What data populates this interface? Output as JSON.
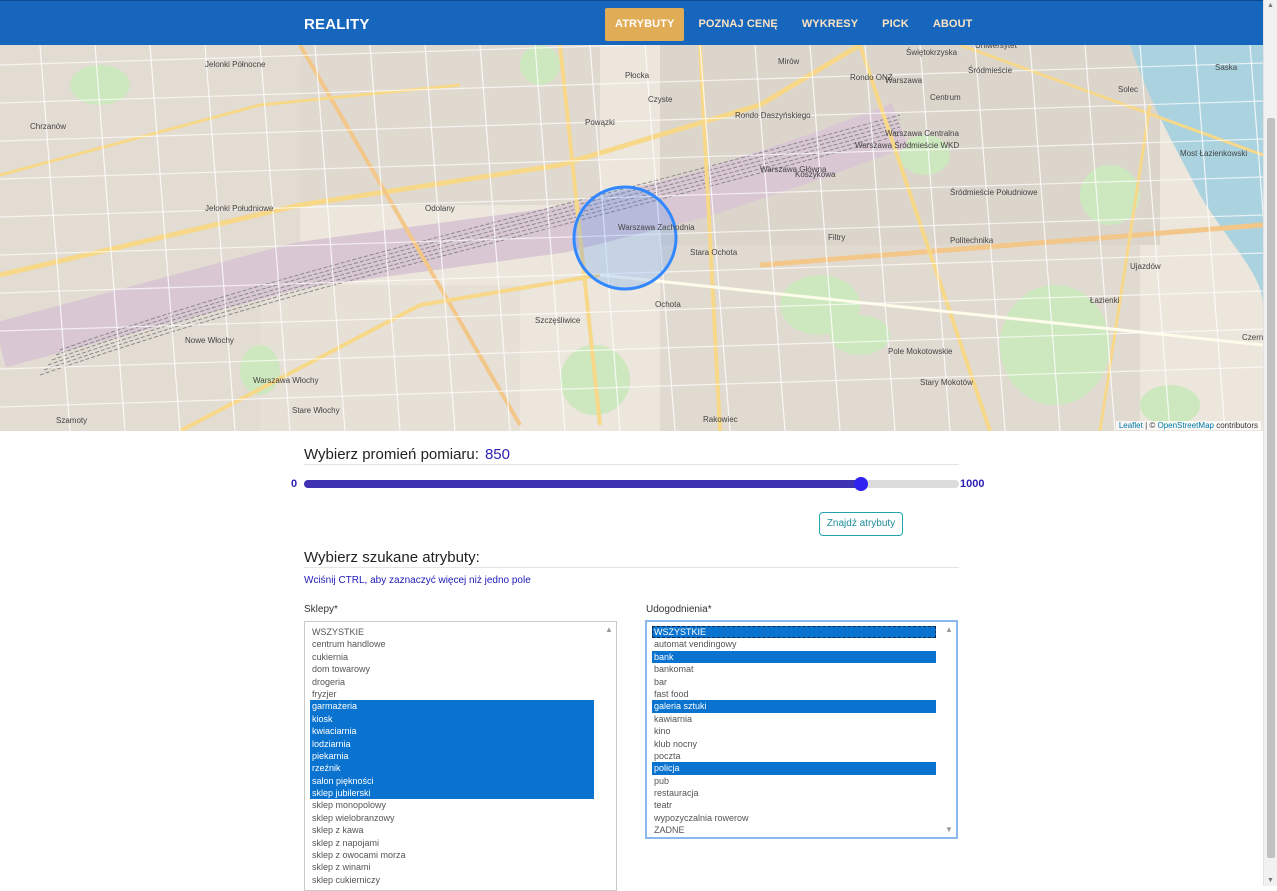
{
  "navbar": {
    "brand": "REALITY",
    "items": [
      {
        "label": "ATRYBUTY",
        "active": true
      },
      {
        "label": "POZNAJ CENĘ",
        "active": false
      },
      {
        "label": "WYKRESY",
        "active": false
      },
      {
        "label": "PICK",
        "active": false
      },
      {
        "label": "ABOUT",
        "active": false
      }
    ]
  },
  "map": {
    "labels": [
      "Jelonki Północne",
      "Chrzanów",
      "Jelonki Południowe",
      "Odolany",
      "Warszawa Zachodnia",
      "Szczęśliwice",
      "Stara Ochota",
      "Ochota",
      "Nowe Włochy",
      "Warszawa Włochy",
      "Stare Włochy",
      "Szamoty",
      "Filtry",
      "Śródmieście Południowe",
      "Warszawa",
      "Śródmieście",
      "Mirów",
      "Koszykowa",
      "Pole Mokotowskie",
      "Stary Mokotów",
      "Rakowiec",
      "Ujazdów",
      "Łazienki",
      "Most Łazienkowski",
      "Czyste",
      "Powązki",
      "Płocka",
      "Rondo Daszyńskiego",
      "Rondo ONZ",
      "Centrum",
      "Warszawa Główna",
      "Warszawa Centralna",
      "Warszawa Śródmieście WKD",
      "Politechnika",
      "Uniwersytet",
      "Świętokrzyska",
      "Solec",
      "Saska",
      "Czerni"
    ],
    "attribution": {
      "leaflet": "Leaflet",
      "sep": " | © ",
      "osm": "OpenStreetMap",
      "suffix": " contributors"
    }
  },
  "radius": {
    "title": "Wybierz promień pomiaru:",
    "value": "850",
    "min": "0",
    "max": "1000",
    "fraction": 0.85
  },
  "find_button": "Znajdź atrybuty",
  "attributes": {
    "title": "Wybierz szukane atrybuty:",
    "hint": "Wciśnij CTRL, aby zaznaczyć więcej niż jedno pole"
  },
  "shops": {
    "label": "Sklepy*",
    "options": [
      {
        "text": "WSZYSTKIE",
        "selected": false
      },
      {
        "text": "centrum handlowe",
        "selected": false
      },
      {
        "text": "cukiernia",
        "selected": false
      },
      {
        "text": "dom towarowy",
        "selected": false
      },
      {
        "text": "drogeria",
        "selected": false
      },
      {
        "text": "fryzjer",
        "selected": false
      },
      {
        "text": "garmażeria",
        "selected": true
      },
      {
        "text": "kiosk",
        "selected": true
      },
      {
        "text": "kwiaciarnia",
        "selected": true
      },
      {
        "text": "lodziarnia",
        "selected": true
      },
      {
        "text": "piekarnia",
        "selected": true
      },
      {
        "text": "rzeźnik",
        "selected": true
      },
      {
        "text": "salon piękności",
        "selected": true
      },
      {
        "text": "sklep jubilerski",
        "selected": true
      },
      {
        "text": "sklep monopolowy",
        "selected": false
      },
      {
        "text": "sklep wielobranzowy",
        "selected": false
      },
      {
        "text": "sklep z kawa",
        "selected": false
      },
      {
        "text": "sklep z napojami",
        "selected": false
      },
      {
        "text": "sklep z owocami morza",
        "selected": false
      },
      {
        "text": "sklep z winami",
        "selected": false
      },
      {
        "text": "sklep cukierniczy",
        "selected": false
      }
    ]
  },
  "amenities": {
    "label": "Udogodnienia*",
    "options": [
      {
        "text": "WSZYSTKIE",
        "selected": true,
        "focus": true
      },
      {
        "text": "automat vendingowy",
        "selected": false
      },
      {
        "text": "bank",
        "selected": true
      },
      {
        "text": "bankomat",
        "selected": false
      },
      {
        "text": "bar",
        "selected": false
      },
      {
        "text": "fast food",
        "selected": false
      },
      {
        "text": "galeria sztuki",
        "selected": true
      },
      {
        "text": "kawiarnia",
        "selected": false
      },
      {
        "text": "kino",
        "selected": false
      },
      {
        "text": "klub nocny",
        "selected": false
      },
      {
        "text": "poczta",
        "selected": false
      },
      {
        "text": "policja",
        "selected": true
      },
      {
        "text": "pub",
        "selected": false
      },
      {
        "text": "restauracja",
        "selected": false
      },
      {
        "text": "teatr",
        "selected": false
      },
      {
        "text": "wypozyczalnia rowerow",
        "selected": false
      },
      {
        "text": "ZADNE",
        "selected": false
      }
    ]
  },
  "colors": {
    "navbar": "#1766bd",
    "nav_active": "#e0ac55",
    "slider_fill": "#3f32b2",
    "selection": "#0a73cf"
  }
}
